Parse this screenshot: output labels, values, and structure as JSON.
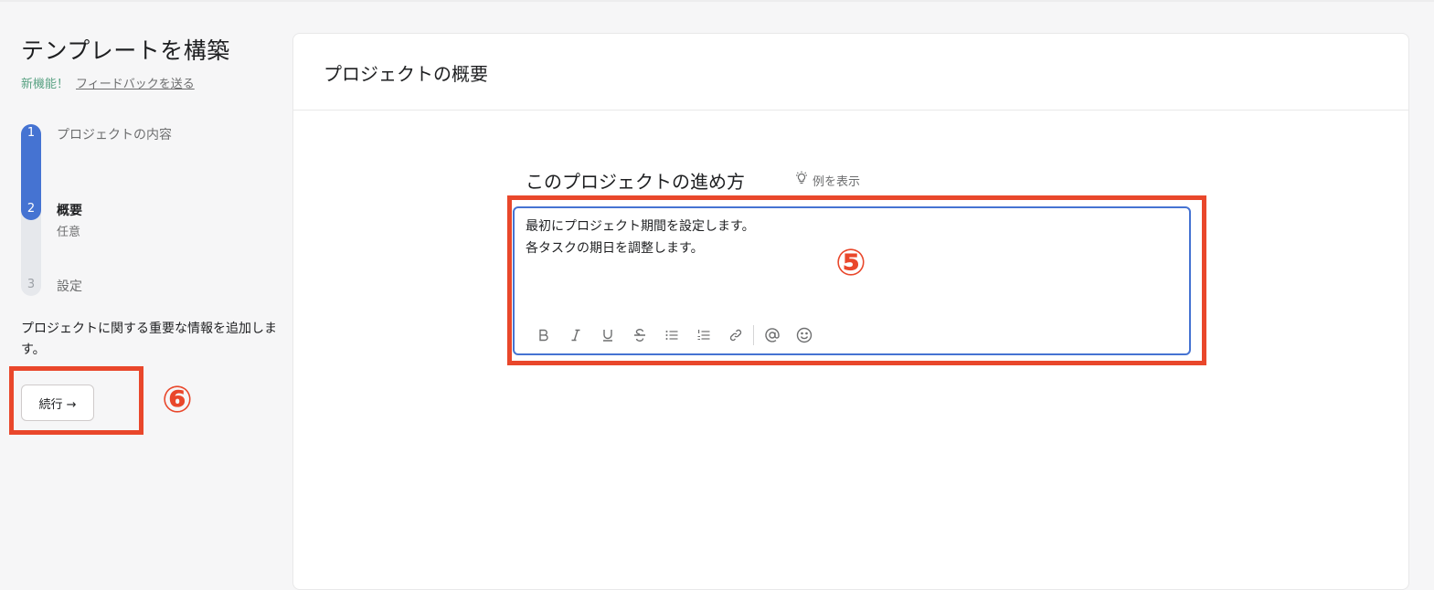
{
  "sidebar": {
    "title": "テンプレートを構築",
    "new_badge": "新機能！",
    "feedback_link": "フィードバックを送る",
    "steps": [
      {
        "num": "1",
        "label": "プロジェクトの内容"
      },
      {
        "num": "2",
        "label": "概要",
        "sublabel": "任意"
      },
      {
        "num": "3",
        "label": "設定"
      }
    ],
    "description": "プロジェクトに関する重要な情報を追加します。",
    "continue_label": "続行 →"
  },
  "main": {
    "header_title": "プロジェクトの概要",
    "section_title": "このプロジェクトの進め方",
    "example_link": "例を表示",
    "editor": {
      "lines": [
        "最初にプロジェクト期間を設定します。",
        "各タスクの期日を調整します。"
      ],
      "toolbar_icons": [
        "bold-icon",
        "italic-icon",
        "underline-icon",
        "strikethrough-icon",
        "bullet-list-icon",
        "numbered-list-icon",
        "link-icon",
        "mention-icon",
        "emoji-icon"
      ]
    }
  },
  "annotations": {
    "editor_marker": "⑤",
    "continue_marker": "⑥"
  },
  "colors": {
    "accent": "#4573d2",
    "annotation": "#e9472b",
    "new_badge": "#58a182"
  }
}
